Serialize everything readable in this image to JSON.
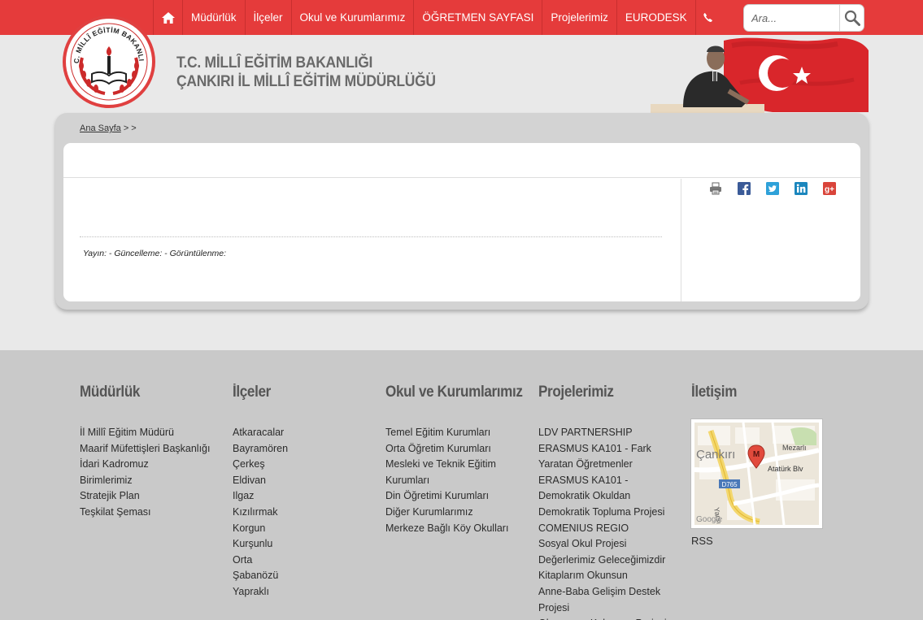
{
  "nav": {
    "home_icon": "home-icon",
    "items": [
      {
        "label": "Müdürlük"
      },
      {
        "label": "İlçeler"
      },
      {
        "label": "Okul ve Kurumlarımız"
      },
      {
        "label": "ÖĞRETMEN SAYFASI"
      },
      {
        "label": "Projelerimiz"
      },
      {
        "label": "EURODESK"
      }
    ],
    "phone_icon": "phone-icon",
    "search": {
      "placeholder": "Ara...",
      "icon": "search-icon"
    }
  },
  "header": {
    "logo_text": "T.C. MİLLÎ EĞİTİM BAKANLIĞI",
    "title_line1": "T.C. MİLLÎ EĞİTİM BAKANLIĞI",
    "title_line2": "ÇANKIRI İL MİLLÎ EĞİTİM MÜDÜRLÜĞÜ"
  },
  "breadcrumb": {
    "home": "Ana Sayfa",
    "separators": " > >"
  },
  "article": {
    "meta": "Yayın: - Güncelleme: - Görüntülenme:",
    "share_icons": [
      "print-icon",
      "facebook-icon",
      "twitter-icon",
      "linkedin-icon",
      "google-plus-icon"
    ]
  },
  "footer": {
    "columns": [
      {
        "title": "Müdürlük",
        "items": [
          "İl Millî Eğitim Müdürü",
          "Maarif Müfettişleri Başkanlığı",
          "İdari Kadromuz",
          "Birimlerimiz",
          "Stratejik Plan",
          "Teşkilat Şeması"
        ]
      },
      {
        "title": "İlçeler",
        "items": [
          "Atkaracalar",
          "Bayramören",
          "Çerkeş",
          "Eldivan",
          "Ilgaz",
          "Kızılırmak",
          "Korgun",
          "Kurşunlu",
          "Orta",
          "Şabanözü",
          "Yapraklı"
        ]
      },
      {
        "title": "Okul ve Kurumlarımız",
        "items": [
          "Temel Eğitim Kurumları",
          "Orta Öğretim Kurumları",
          "Mesleki ve Teknik Eğitim Kurumları",
          "Din Öğretimi Kurumları",
          "Diğer Kurumlarımız",
          "Merkeze Bağlı Köy Okulları"
        ]
      },
      {
        "title": "Projelerimiz",
        "items": [
          "LDV PARTNERSHIP",
          "ERASMUS KA101 - Fark Yaratan Öğretmenler",
          "ERASMUS KA101 - Demokratik Okuldan Demokratik Topluma Projesi",
          "COMENIUS REGIO",
          "Sosyal Okul Projesi",
          "Değerlerimiz Geleceğimizdir",
          "Kitaplarım Okunsun",
          "Anne-Baba Gelişim Destek Projesi",
          "Okumayan Kalmasın Projesi"
        ]
      },
      {
        "title": "İletişim",
        "map": {
          "city": "Çankırı",
          "street": "Atatürk Blv",
          "road": "D765",
          "district": "Mezarlı",
          "marker": "M",
          "credit": "Google",
          "yarsi": "Yarsı"
        },
        "rss": "RSS"
      }
    ]
  }
}
